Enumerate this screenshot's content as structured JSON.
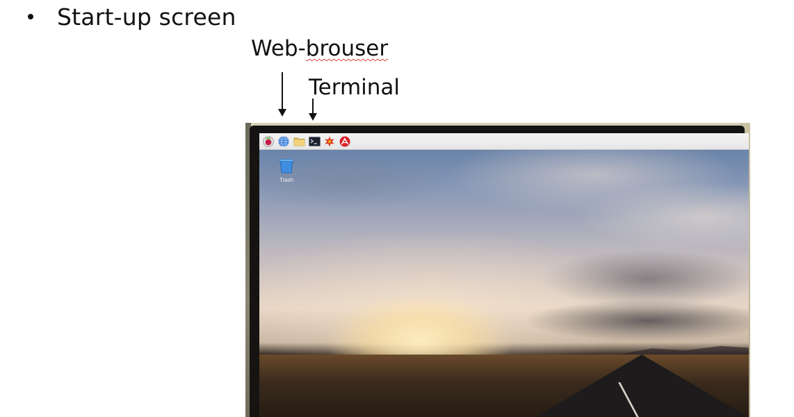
{
  "slide": {
    "bullet": "Start-up screen",
    "labels": {
      "web_browser_prefix": "Web-",
      "web_browser_misspelled": "brouser",
      "terminal": "Terminal"
    }
  },
  "desktop": {
    "taskbar_icons": [
      "raspberry-menu-icon",
      "web-browser-icon",
      "file-manager-icon",
      "terminal-icon",
      "wolfram-icon",
      "mathematica-icon"
    ],
    "desktop_items": [
      {
        "icon": "trash-icon",
        "label": "Trash"
      }
    ]
  },
  "colors": {
    "annotation": "#111111",
    "spellcheck_underline": "#e04040",
    "taskbar": "#eeeeee"
  }
}
